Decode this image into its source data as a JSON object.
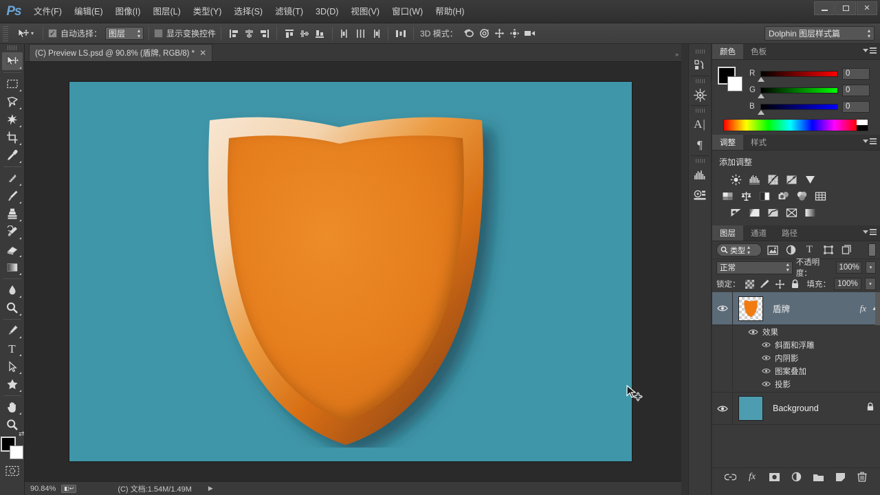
{
  "app": {
    "logo": "Ps"
  },
  "menubar": {
    "items": [
      {
        "label": "文件(F)",
        "name": "menu-file"
      },
      {
        "label": "编辑(E)",
        "name": "menu-edit"
      },
      {
        "label": "图像(I)",
        "name": "menu-image"
      },
      {
        "label": "图层(L)",
        "name": "menu-layer"
      },
      {
        "label": "类型(Y)",
        "name": "menu-type"
      },
      {
        "label": "选择(S)",
        "name": "menu-select"
      },
      {
        "label": "滤镜(T)",
        "name": "menu-filter"
      },
      {
        "label": "3D(D)",
        "name": "menu-3d"
      },
      {
        "label": "视图(V)",
        "name": "menu-view"
      },
      {
        "label": "窗口(W)",
        "name": "menu-window"
      },
      {
        "label": "帮助(H)",
        "name": "menu-help"
      }
    ],
    "window_controls": {
      "minimize": "minimize-icon",
      "maximize": "maximize-icon",
      "close": "✕"
    }
  },
  "options_bar": {
    "tool": "move-tool",
    "auto_select_label": "自动选择：",
    "auto_select_checked": "✓",
    "auto_select_value": "图层",
    "show_transform_label": "显示变换控件",
    "show_transform_checked": false,
    "mode_3d_label": "3D 模式：",
    "workspace": "Dolphin 图层样式篇",
    "align_icons": [
      "align-left-edges-icon",
      "align-horizontal-centers-icon",
      "align-right-edges-icon",
      "align-top-edges-icon",
      "align-vertical-centers-icon",
      "align-bottom-edges-icon",
      "distribute-left-icon",
      "distribute-horizontal-center-icon",
      "distribute-right-icon",
      "distribute-spacing-icon"
    ],
    "mode_3d_icons": [
      "rotate-3d-icon",
      "roll-3d-icon",
      "drag-3d-icon",
      "slide-3d-icon",
      "scale-3d-icon"
    ]
  },
  "document": {
    "tab_title": "(C) Preview LS.psd @ 90.8% (盾牌, RGB/8) *",
    "close_label": "✕"
  },
  "toolbar": {
    "tools": [
      {
        "name": "move-tool",
        "glyph": "move",
        "active": true,
        "group": 0
      },
      {
        "name": "rectangular-marquee-tool",
        "glyph": "marquee",
        "active": false,
        "group": 1
      },
      {
        "name": "lasso-tool",
        "glyph": "lasso",
        "active": false,
        "group": 1
      },
      {
        "name": "magic-wand-tool",
        "glyph": "wand",
        "active": false,
        "group": 1
      },
      {
        "name": "crop-tool",
        "glyph": "crop",
        "active": false,
        "group": 1
      },
      {
        "name": "eyedropper-tool",
        "glyph": "eyedropper",
        "active": false,
        "group": 1
      },
      {
        "name": "spot-healing-brush-tool",
        "glyph": "healing",
        "active": false,
        "group": 2
      },
      {
        "name": "brush-tool",
        "glyph": "brush",
        "active": false,
        "group": 2
      },
      {
        "name": "clone-stamp-tool",
        "glyph": "stamp",
        "active": false,
        "group": 2
      },
      {
        "name": "history-brush-tool",
        "glyph": "historybrush",
        "active": false,
        "group": 2
      },
      {
        "name": "eraser-tool",
        "glyph": "eraser",
        "active": false,
        "group": 2
      },
      {
        "name": "gradient-tool",
        "glyph": "gradient",
        "active": false,
        "group": 2
      },
      {
        "name": "blur-tool",
        "glyph": "blur",
        "active": false,
        "group": 3
      },
      {
        "name": "dodge-tool",
        "glyph": "dodge",
        "active": false,
        "group": 3
      },
      {
        "name": "pen-tool",
        "glyph": "pen",
        "active": false,
        "group": 4
      },
      {
        "name": "horizontal-type-tool",
        "glyph": "type",
        "active": false,
        "group": 4
      },
      {
        "name": "path-selection-tool",
        "glyph": "pathselect",
        "active": false,
        "group": 4
      },
      {
        "name": "custom-shape-tool",
        "glyph": "shape",
        "active": false,
        "group": 4
      },
      {
        "name": "hand-tool",
        "glyph": "hand",
        "active": false,
        "group": 5
      },
      {
        "name": "zoom-tool",
        "glyph": "zoom",
        "active": false,
        "group": 5
      }
    ],
    "foreground_color": "#000000",
    "background_color": "#ffffff",
    "quick_mask": "quick-mask-icon"
  },
  "canvas": {
    "background_color": "#3f96a8",
    "shield": {
      "fill_color": "#e87b16",
      "highlight_color": "#f7e0c3",
      "shadow_color": "#8c4208",
      "name": "shield-artwork"
    },
    "cursor": "move-tool-cursor"
  },
  "status_bar": {
    "zoom": "90.84%",
    "doc_info": "(C) 文档:1.54M/1.49M",
    "arrow": "▶"
  },
  "dock_rail": {
    "icons": [
      {
        "name": "history-panel-icon",
        "glyph": "history"
      },
      {
        "name": "3d-panel-icon",
        "glyph": "wheel"
      },
      {
        "name": "character-panel-icon",
        "glyph": "A|"
      },
      {
        "name": "paragraph-panel-icon",
        "glyph": "¶"
      },
      {
        "name": "histogram-panel-icon",
        "glyph": "histogram"
      },
      {
        "name": "properties-panel-icon",
        "glyph": "props"
      }
    ]
  },
  "color_panel": {
    "tabs": [
      {
        "label": "颜色",
        "name": "tab-color",
        "active": true
      },
      {
        "label": "色板",
        "name": "tab-swatches",
        "active": false
      }
    ],
    "foreground": "#000000",
    "background": "#ffffff",
    "sliders": [
      {
        "label": "R",
        "value": "0",
        "gradient": "linear-gradient(to right,#000000,#ff0000)"
      },
      {
        "label": "G",
        "value": "0",
        "gradient": "linear-gradient(to right,#000000,#00ff00)"
      },
      {
        "label": "B",
        "value": "0",
        "gradient": "linear-gradient(to right,#000000,#0000ff)"
      }
    ]
  },
  "adjustments_panel": {
    "tabs": [
      {
        "label": "调整",
        "name": "tab-adjustments",
        "active": true
      },
      {
        "label": "样式",
        "name": "tab-styles",
        "active": false
      }
    ],
    "title": "添加调整",
    "rows": [
      [
        "brightness-contrast-icon",
        "levels-icon",
        "curves-icon",
        "exposure-icon",
        "vibrance-icon"
      ],
      [
        "hue-saturation-icon",
        "color-balance-icon",
        "black-white-icon",
        "photo-filter-icon",
        "channel-mixer-icon",
        "color-lookup-icon"
      ],
      [
        "invert-icon",
        "posterize-icon",
        "threshold-icon",
        "selective-color-icon",
        "gradient-map-icon"
      ]
    ]
  },
  "layers_panel": {
    "tabs": [
      {
        "label": "图层",
        "name": "tab-layers",
        "active": true
      },
      {
        "label": "通道",
        "name": "tab-channels",
        "active": false
      },
      {
        "label": "路径",
        "name": "tab-paths",
        "active": false
      }
    ],
    "filter_label": "类型",
    "filter_icons": [
      "filter-pixel-icon",
      "filter-adjustment-icon",
      "filter-type-icon",
      "filter-shape-icon",
      "filter-smart-object-icon"
    ],
    "blend_mode": "正常",
    "opacity_label": "不透明度：",
    "opacity_value": "100%",
    "lock_label": "锁定：",
    "lock_icons": [
      "lock-transparent-pixels-icon",
      "lock-image-pixels-icon",
      "lock-position-icon",
      "lock-all-icon"
    ],
    "fill_label": "填充：",
    "fill_value": "100%",
    "layers": [
      {
        "name": "盾牌",
        "selected": true,
        "visible": true,
        "has_fx": true,
        "fx_badge": "fx",
        "thumb_type": "shield",
        "effects_group_label": "效果",
        "effects": [
          "斜面和浮雕",
          "内阴影",
          "图案叠加",
          "投影"
        ]
      },
      {
        "name": "Background",
        "selected": false,
        "visible": true,
        "has_fx": false,
        "locked": true,
        "thumb_type": "solid",
        "thumb_color": "#4d9cb0"
      }
    ],
    "bottom_icons": [
      {
        "name": "link-layers-button",
        "glyph": "link"
      },
      {
        "name": "add-layer-style-button",
        "glyph": "fx"
      },
      {
        "name": "add-layer-mask-button",
        "glyph": "mask"
      },
      {
        "name": "new-fill-adjustment-layer-button",
        "glyph": "adj"
      },
      {
        "name": "new-group-button",
        "glyph": "folder"
      },
      {
        "name": "new-layer-button",
        "glyph": "newlayer"
      },
      {
        "name": "delete-layer-button",
        "glyph": "trash"
      }
    ]
  }
}
